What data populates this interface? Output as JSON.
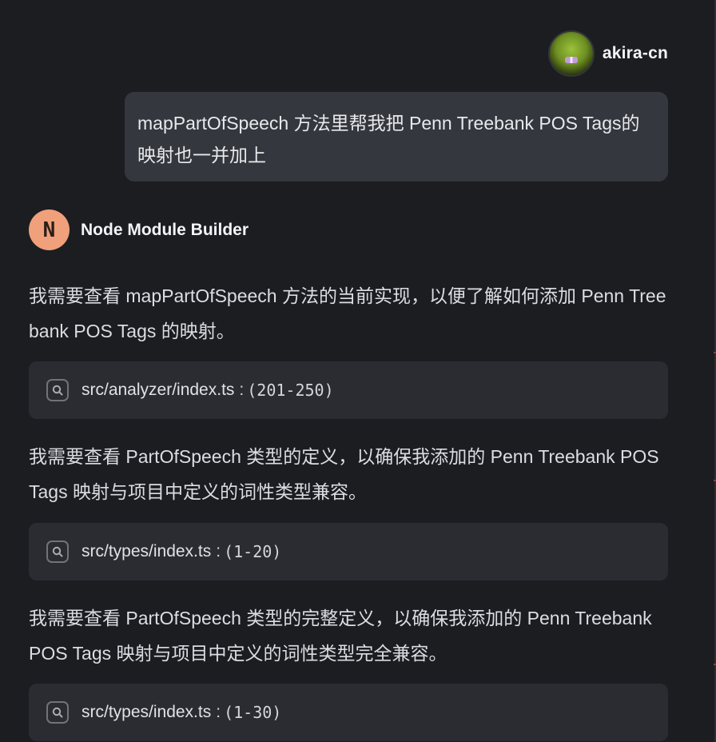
{
  "user": {
    "name": "akira-cn",
    "message": "mapPartOfSpeech 方法里帮我把 Penn Treebank POS Tags的映射也一并加上"
  },
  "assistant": {
    "name": "Node Module Builder",
    "avatar_letter": "N",
    "avatar_color": "#f0a07a",
    "steps": [
      {
        "text": "我需要查看 mapPartOfSpeech 方法的当前实现，以便了解如何添加 Penn Treebank POS Tags 的映射。",
        "tool": {
          "icon": "search-icon",
          "file": "src/analyzer/index.ts",
          "separator": ":",
          "range": "(201-250)"
        }
      },
      {
        "text": "我需要查看 PartOfSpeech 类型的定义，以确保我添加的 Penn Treebank POS Tags 映射与项目中定义的词性类型兼容。",
        "tool": {
          "icon": "search-icon",
          "file": "src/types/index.ts",
          "separator": ":",
          "range": "(1-20)"
        }
      },
      {
        "text": "我需要查看 PartOfSpeech 类型的完整定义，以确保我添加的 Penn Treebank POS Tags 映射与项目中定义的词性类型完全兼容。",
        "tool": {
          "icon": "search-icon",
          "file": "src/types/index.ts",
          "separator": ":",
          "range": "(1-30)"
        }
      }
    ]
  },
  "colors": {
    "background": "#1c1d21",
    "user_bubble": "#35373e",
    "tool_card": "#2a2c32"
  }
}
